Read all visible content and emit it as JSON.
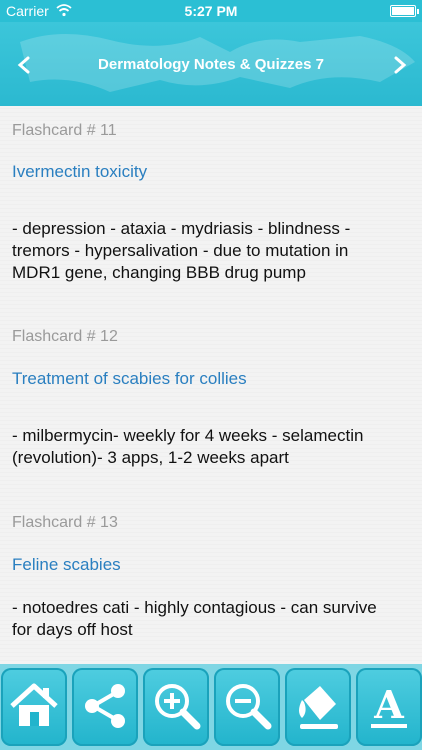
{
  "status_bar": {
    "carrier": "Carrier",
    "time": "5:27 PM",
    "battery_level": 1.0,
    "wifi_icon": "wifi-icon",
    "battery_icon": "battery-icon"
  },
  "header": {
    "title": "Dermatology Notes & Quizzes 7",
    "prev_icon": "chevron-left-icon",
    "next_icon": "chevron-right-icon",
    "background_color": "#2bb9d0"
  },
  "flashcards": [
    {
      "number": "Flashcard # 11",
      "topic": "Ivermectin toxicity",
      "lines": [
        "- depression - ataxia - mydriasis - blindness -",
        "tremors - hypersalivation - due to mutation in",
        "MDR1 gene, changing BBB drug pump"
      ]
    },
    {
      "number": "Flashcard # 12",
      "topic": "Treatment of scabies for collies",
      "lines": [
        "- milbermycin- weekly for 4 weeks - selamectin",
        "(revolution)- 3 apps, 1-2 weeks apart"
      ]
    },
    {
      "number": "Flashcard # 13",
      "topic": "Feline scabies",
      "lines": [
        "- notoedres cati - highly contagious - can survive",
        "for days off host"
      ]
    }
  ],
  "toolbar": {
    "buttons": [
      {
        "name": "home-button",
        "icon": "home-icon"
      },
      {
        "name": "share-button",
        "icon": "share-icon"
      },
      {
        "name": "zoom-in-button",
        "icon": "zoom-in-icon"
      },
      {
        "name": "zoom-out-button",
        "icon": "zoom-out-icon"
      },
      {
        "name": "paint-bucket-button",
        "icon": "paint-bucket-icon"
      },
      {
        "name": "font-button",
        "icon": "font-icon"
      }
    ],
    "accent_color": "#22b4cc",
    "font_button_letter": "A"
  }
}
